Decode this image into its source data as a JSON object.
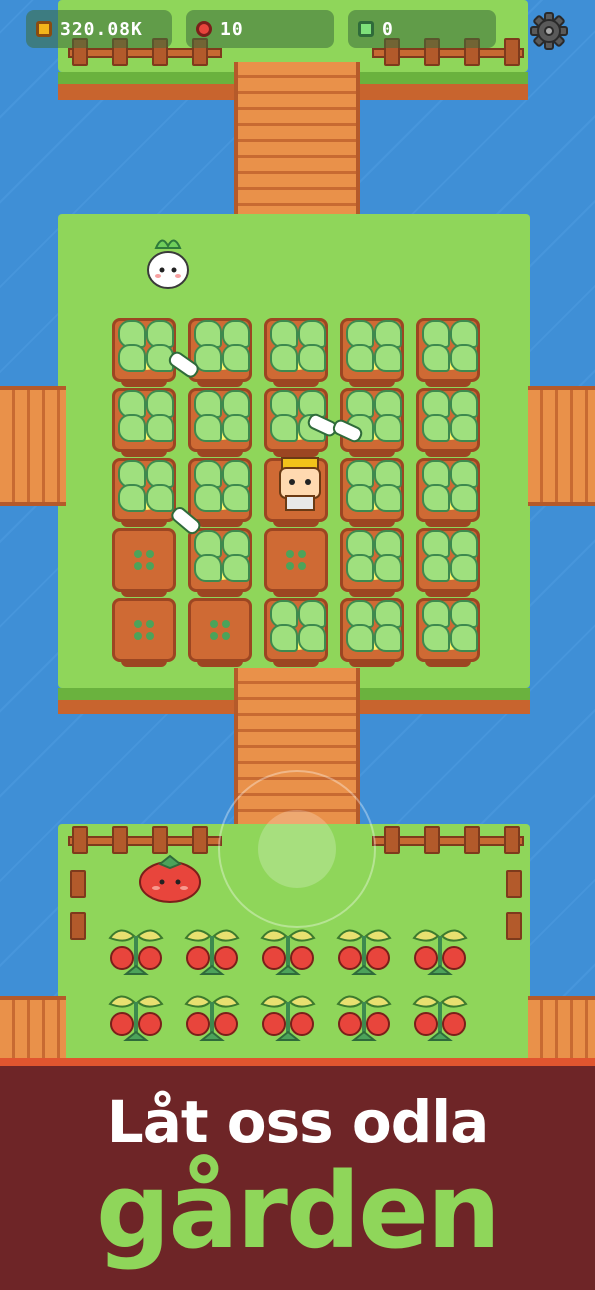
{
  "hud": {
    "coins": "320.08K",
    "tomatoes": "10",
    "gems": "0",
    "coin_icon": "coin-icon",
    "tomato_icon": "tomato-icon",
    "gem_icon": "gem-icon",
    "settings_icon": "gear-icon"
  },
  "banner": {
    "line1": "Låt oss odla",
    "line2": "gården"
  },
  "colors": {
    "water": "#3f8fd6",
    "grass": "#8fd65a",
    "banner_bg": "#6e2527",
    "banner_accent": "#e0552f",
    "banner_title_green": "#8fd65a"
  },
  "farm_plots": {
    "rows": 5,
    "cols": 5,
    "grown": [
      [
        true,
        true,
        true,
        true,
        true
      ],
      [
        true,
        true,
        true,
        true,
        true
      ],
      [
        true,
        true,
        false,
        true,
        true
      ],
      [
        false,
        true,
        false,
        true,
        true
      ],
      [
        false,
        false,
        true,
        true,
        true
      ]
    ]
  },
  "tomato_rows": 2,
  "tomato_cols": 5
}
